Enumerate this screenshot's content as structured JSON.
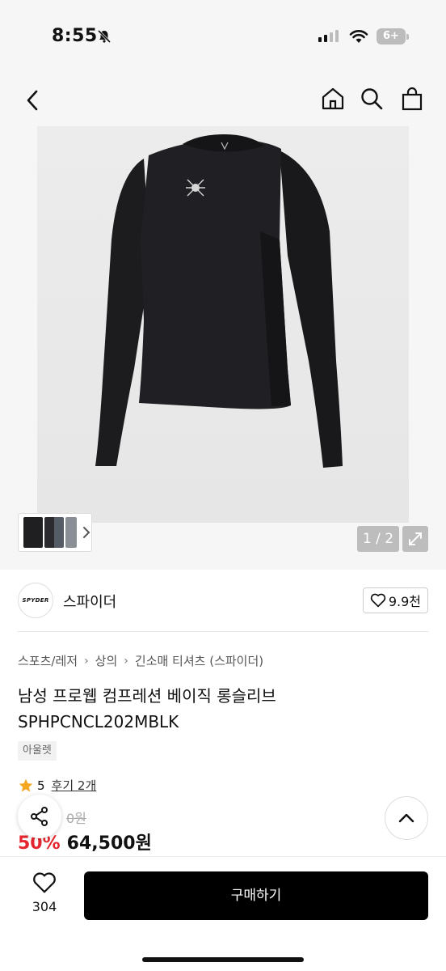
{
  "status": {
    "time": "8:55",
    "battery": "6+"
  },
  "gallery": {
    "page_indicator": "1 / 2"
  },
  "brand": {
    "logo_text": "SPYDER",
    "name": "스파이더",
    "likes": "9.9천"
  },
  "breadcrumb": [
    "스포츠/레저",
    "상의",
    "긴소매 티셔츠 (스파이더)"
  ],
  "product": {
    "title": "남성 프로웹 컴프레션 베이직 롱슬리브 SPHPCNCL202MBLK",
    "tag": "아울렛",
    "rating": "5",
    "review_link": "후기 2개",
    "original_price": "0원",
    "discount": "50%",
    "price": "64,500원"
  },
  "bottom": {
    "wish_count": "304",
    "buy_label": "구매하기"
  },
  "colors": {
    "accent": "#e5262e",
    "buy_button": "#000000",
    "star": "#f5a623"
  }
}
